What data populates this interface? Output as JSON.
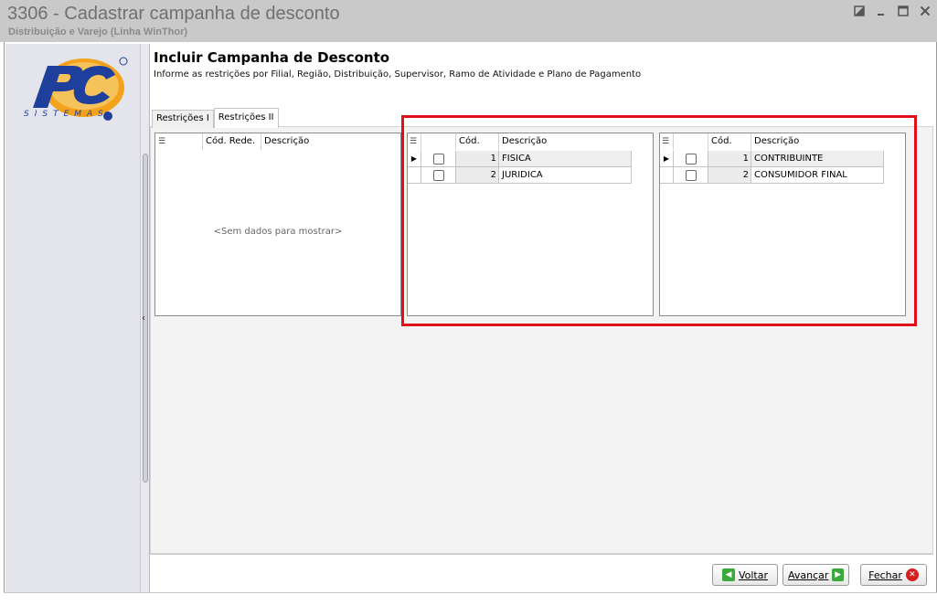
{
  "window": {
    "title": "3306 - Cadastrar campanha de desconto",
    "subtitle": "Distribuição e Varejo (Linha WinThor)",
    "controls": [
      "restore-icon",
      "minimize-icon",
      "maximize-icon",
      "close-icon"
    ]
  },
  "sidebar": {
    "logo_text": "PC",
    "logo_subtext": "SISTEMAS"
  },
  "page": {
    "title": "Incluir Campanha de Desconto",
    "description": "Informe as restrições por Filial, Região, Distribuição, Supervisor, Ramo de Atividade e Plano de Pagamento"
  },
  "tabs": [
    {
      "label": "Restrições I",
      "active": false
    },
    {
      "label": "Restrições II",
      "active": true
    }
  ],
  "grids": {
    "rede": {
      "columns": [
        "Cód. Rede.",
        "Descrição"
      ],
      "rows": [],
      "empty_text": "<Sem dados para mostrar>"
    },
    "tipo_pessoa": {
      "columns": [
        "Cód.",
        "Descrição"
      ],
      "rows": [
        {
          "cod": "1",
          "descricao": "FISICA",
          "checked": false
        },
        {
          "cod": "2",
          "descricao": "JURIDICA",
          "checked": false
        }
      ]
    },
    "tipo_cliente": {
      "columns": [
        "Cód.",
        "Descrição"
      ],
      "rows": [
        {
          "cod": "1",
          "descricao": "CONTRIBUINTE",
          "checked": false
        },
        {
          "cod": "2",
          "descricao": "CONSUMIDOR FINAL",
          "checked": false
        }
      ]
    }
  },
  "buttons": {
    "voltar": "Voltar",
    "avancar": "Avançar",
    "fechar": "Fechar"
  },
  "colors": {
    "highlight_box": "#e0101a",
    "titlebar": "#c9c9c9",
    "logo_blue": "#1f3f9c",
    "logo_orange": "#f08a10"
  }
}
